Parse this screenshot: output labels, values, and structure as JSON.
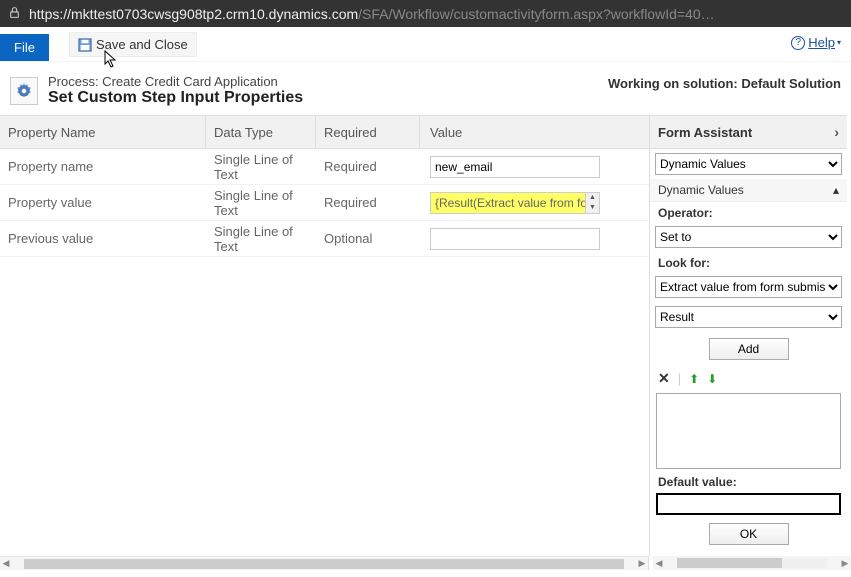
{
  "url": {
    "host": "https://mkttest0703cwsg908tp2.crm10.dynamics.com",
    "path": "/SFA/Workflow/customactivityform.aspx?workflowId=40…"
  },
  "toolbar": {
    "file_label": "File",
    "save_close_label": "Save and Close",
    "help_label": "Help"
  },
  "header": {
    "process_line": "Process: Create Credit Card Application",
    "title": "Set Custom Step Input Properties",
    "working_on": "Working on solution: Default Solution"
  },
  "grid": {
    "headers": {
      "property_name": "Property Name",
      "data_type": "Data Type",
      "required": "Required",
      "value": "Value"
    },
    "rows": [
      {
        "name": "Property name",
        "type": "Single Line of Text",
        "req": "Required",
        "value": "new_email",
        "kind": "text"
      },
      {
        "name": "Property value",
        "type": "Single Line of Text",
        "req": "Required",
        "value": "{Result(Extract value from form",
        "kind": "spin"
      },
      {
        "name": "Previous value",
        "type": "Single Line of Text",
        "req": "Optional",
        "value": "",
        "kind": "text"
      }
    ]
  },
  "form_assistant": {
    "title": "Form Assistant",
    "dynamic_values_select": "Dynamic Values",
    "dynamic_values_label": "Dynamic Values",
    "operator_label": "Operator:",
    "operator_value": "Set to",
    "look_for_label": "Look for:",
    "look_for_entity": "Extract value from form submission",
    "look_for_field": "Result",
    "add_label": "Add",
    "default_value_label": "Default value:",
    "ok_label": "OK"
  }
}
